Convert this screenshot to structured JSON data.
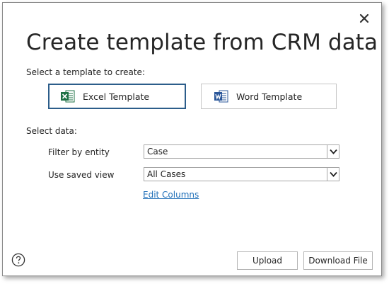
{
  "dialog": {
    "title": "Create template from CRM data",
    "template_prompt": "Select a template to create:",
    "templates": [
      {
        "label": "Excel Template",
        "icon": "excel-icon",
        "selected": true
      },
      {
        "label": "Word Template",
        "icon": "word-icon",
        "selected": false
      }
    ],
    "select_data_label": "Select data:",
    "filter_label": "Filter by entity",
    "filter_value": "Case",
    "view_label": "Use saved view",
    "view_value": "All Cases",
    "edit_columns_link": "Edit Columns",
    "upload_label": "Upload",
    "download_label": "Download File",
    "close_icon": "close-icon",
    "help_icon": "help-icon"
  },
  "colors": {
    "selected_border": "#2c5d8a",
    "link": "#1f6fb8",
    "excel_green": "#1e7145",
    "word_blue": "#2b579a"
  }
}
